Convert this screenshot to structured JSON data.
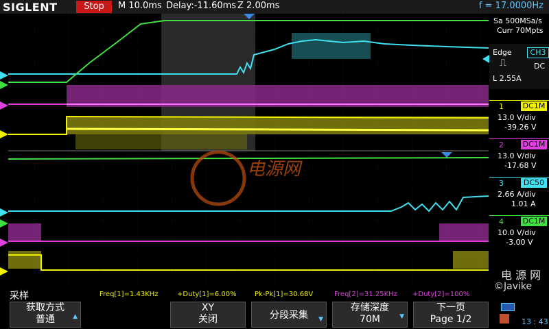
{
  "top": {
    "brand": "SIGLENT",
    "run_state": "Stop",
    "timebase": "M 10.0ms",
    "delay": "Delay:-11.60ms",
    "zoom": "Z 2.00ms",
    "frequency": "f = 17.0000Hz"
  },
  "acquisition": {
    "sample_rate": "Sa 500MSa/s",
    "memory": "Curr 70Mpts"
  },
  "trigger": {
    "type": "Edge",
    "source": "CH3",
    "coupling": "DC",
    "level": "L  2.55A"
  },
  "channels": [
    {
      "num": "1",
      "coupling": "DC1M",
      "scale": "13.0 V/div",
      "offset": "-39.26 V",
      "color": "#f0f000"
    },
    {
      "num": "2",
      "coupling": "DC1M",
      "scale": "13.0 V/div",
      "offset": "-17.68 V",
      "color": "#e040e0"
    },
    {
      "num": "3",
      "coupling": "DC50",
      "scale": "2.66 A/div",
      "offset": "1.01 A",
      "color": "#40e0f0"
    },
    {
      "num": "4",
      "coupling": "DC1M",
      "scale": "10.0 V/div",
      "offset": "-3.00 V",
      "color": "#40e040"
    }
  ],
  "watermark": {
    "cn": "电源网",
    "side_cn": "电 源 网",
    "author": "©Javike"
  },
  "measurements": {
    "label": "采样",
    "freq1": "Freq[1]=1.43KHz",
    "duty1": "+Duty[1]=6.00%",
    "pkpk1": "Pk-Pk[1]=30.68V",
    "freq2": "Freq[2]=31.25KHz",
    "duty2": "+Duty[2]=100%"
  },
  "menu": {
    "acq_mode_title": "获取方式",
    "acq_mode_value": "普通",
    "xy_title": "XY",
    "xy_value": "关闭",
    "segment": "分段采集",
    "depth_title": "存储深度",
    "depth_value": "70M",
    "next_title": "下一页",
    "next_value": "Page 1/2"
  },
  "status": {
    "time": "13 : 43"
  },
  "colors": {
    "ch1": "#f0f000",
    "ch2": "#e040e0",
    "ch3": "#40e0f0",
    "ch4": "#40e040",
    "accent": "#5cc7ff",
    "stop": "#c81818"
  }
}
